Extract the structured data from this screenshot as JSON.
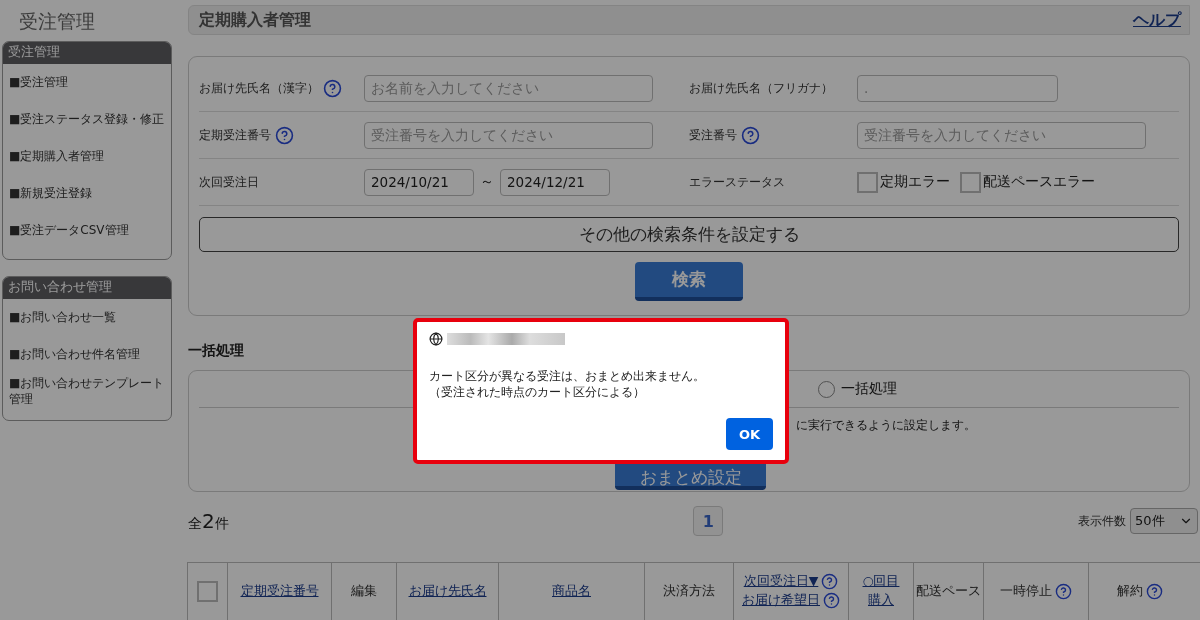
{
  "sidebar": {
    "title": "受注管理",
    "sections": [
      {
        "title": "受注管理",
        "items": [
          "■受注管理",
          "■受注ステータス登録・修正",
          "■定期購入者管理",
          "■新規受注登録",
          "■受注データCSV管理"
        ]
      },
      {
        "title": "お問い合わせ管理",
        "items": [
          "■お問い合わせ一覧",
          "■お問い合わせ件名管理",
          "■お問い合わせテンプレート管理"
        ]
      }
    ]
  },
  "page_title": "定期購入者管理",
  "help_link": "ヘルプ",
  "search": {
    "rows": [
      [
        {
          "label": "お届け先氏名（漢字）",
          "help": true,
          "kind": "text",
          "placeholder": "お名前を入力してください"
        },
        {
          "label": "お届け先氏名（フリガナ）",
          "kind": "text",
          "placeholder": "."
        }
      ],
      [
        {
          "label": "定期受注番号",
          "help": true,
          "kind": "text",
          "placeholder": "受注番号を入力してください"
        },
        {
          "label": "受注番号",
          "help": true,
          "kind": "text",
          "placeholder": "受注番号を入力してください"
        }
      ],
      [
        {
          "label": "次回受注日",
          "kind": "date-range",
          "from": "2024/10/21",
          "separator": "～",
          "to": "2024/12/21"
        },
        {
          "label": "エラーステータス",
          "kind": "checkboxes",
          "options": [
            {
              "label": "定期エラー",
              "checked": false
            },
            {
              "label": "配送ペースエラー",
              "checked": false
            }
          ]
        }
      ]
    ],
    "more_button": "その他の検索条件を設定する",
    "search_button": "検索"
  },
  "bulk": {
    "title": "一括処理",
    "radio": {
      "label": "一括処理",
      "selected": false
    },
    "note": "に実行できるように設定します。",
    "button": "おまとめ設定"
  },
  "results": {
    "total": {
      "prefix": "全",
      "count": "2",
      "suffix": "件"
    },
    "pages": [
      {
        "label": "1",
        "selected": true
      }
    ],
    "per_page": {
      "label": "表示件数",
      "value": "50件"
    }
  },
  "table": {
    "columns": [
      {
        "kind": "checkbox",
        "checked": false
      },
      {
        "kind": "text",
        "lines": [
          {
            "text": "定期受注番号",
            "link": true
          }
        ]
      },
      {
        "kind": "text",
        "lines": [
          {
            "text": "編集",
            "link": false
          }
        ]
      },
      {
        "kind": "text",
        "lines": [
          {
            "text": "お届け先氏名",
            "link": true
          }
        ]
      },
      {
        "kind": "text",
        "lines": [
          {
            "text": "商品名",
            "link": true
          }
        ]
      },
      {
        "kind": "text",
        "lines": [
          {
            "text": "決済方法",
            "link": false
          }
        ]
      },
      {
        "kind": "text",
        "lines": [
          {
            "text": "次回受注日▼",
            "link": true,
            "help": true
          },
          {
            "text": "お届け希望日",
            "link": true,
            "help": true
          }
        ]
      },
      {
        "kind": "text",
        "lines": [
          {
            "text": "○回目",
            "link": true
          },
          {
            "text": "購入",
            "link": true
          }
        ]
      },
      {
        "kind": "text",
        "lines": [
          {
            "text": "配送ペース",
            "link": false
          }
        ]
      },
      {
        "kind": "text",
        "lines": [
          {
            "text": "一時停止",
            "link": false,
            "help": true
          }
        ]
      },
      {
        "kind": "text",
        "lines": [
          {
            "text": "解約",
            "link": false,
            "help": true
          }
        ]
      }
    ]
  },
  "dialog": {
    "message": [
      "カート区分が異なる受注は、おまとめ出来ません。",
      "（受注された時点のカート区分による）"
    ],
    "button": "OK"
  }
}
